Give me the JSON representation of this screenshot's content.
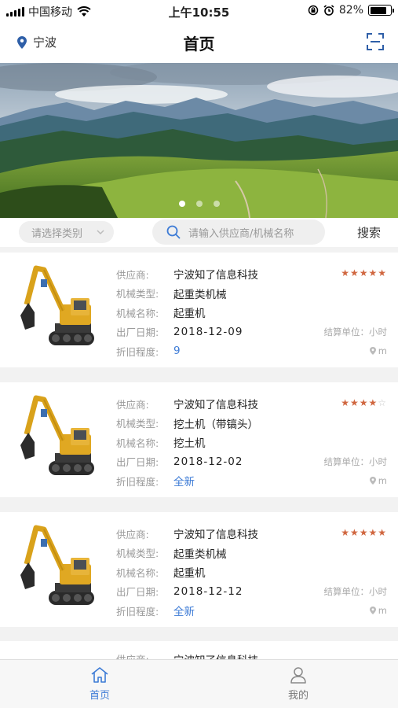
{
  "status_bar": {
    "carrier": "中国移动",
    "time": "上午10:55",
    "battery": "82%",
    "battery_level": 0.82
  },
  "nav": {
    "location": "宁波",
    "title": "首页"
  },
  "banner": {
    "slide_count": 3,
    "active_slide": 0
  },
  "filter": {
    "category_placeholder": "请选择类别",
    "search_placeholder": "请输入供应商/机械名称",
    "search_button": "搜索"
  },
  "labels": {
    "supplier": "供应商:",
    "machine_type": "机械类型:",
    "machine_name": "机械名称:",
    "factory_date": "出厂日期:",
    "depreciation": "折旧程度:",
    "settlement_unit": "结算单位：小时",
    "distance": "m"
  },
  "items": [
    {
      "supplier": "宁波知了信息科技",
      "machine_type": "起重类机械",
      "machine_name": "起重机",
      "factory_date": "2018-12-09",
      "depreciation": "9",
      "rating": 5
    },
    {
      "supplier": "宁波知了信息科技",
      "machine_type": "挖土机（带镐头）",
      "machine_name": "挖土机",
      "factory_date": "2018-12-02",
      "depreciation": "全新",
      "rating": 4
    },
    {
      "supplier": "宁波知了信息科技",
      "machine_type": "起重类机械",
      "machine_name": "起重机",
      "factory_date": "2018-12-12",
      "depreciation": "全新",
      "rating": 5
    }
  ],
  "tabs": [
    {
      "label": "首页",
      "active": true
    },
    {
      "label": "我的",
      "active": false
    }
  ],
  "colors": {
    "accent": "#3d7bd6",
    "star": "#d0663f",
    "page_bg": "#f2f2f2"
  }
}
